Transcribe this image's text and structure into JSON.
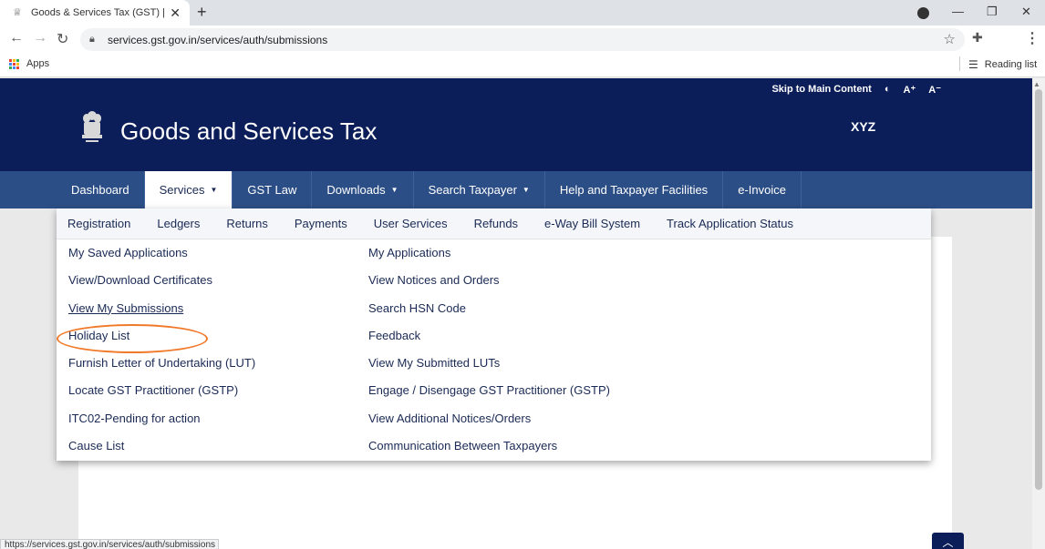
{
  "browser": {
    "tab_title": "Goods & Services Tax (GST) | User",
    "new_tab_symbol": "+",
    "url": "services.gst.gov.in/services/auth/submissions",
    "bookmarks": {
      "apps_label": "Apps",
      "reading_list_label": "Reading list"
    },
    "status_url": "https://services.gst.gov.in/services/auth/submissions"
  },
  "site": {
    "utility": {
      "skip_label": "Skip to Main Content",
      "contrast_symbol": "◐",
      "font_increase": "A⁺",
      "font_decrease": "A⁻"
    },
    "title": "Goods and Services Tax",
    "user_name": "XYZ",
    "nav": [
      {
        "label": "Dashboard",
        "dropdown": false
      },
      {
        "label": "Services",
        "dropdown": true
      },
      {
        "label": "GST Law",
        "dropdown": false
      },
      {
        "label": "Downloads",
        "dropdown": true
      },
      {
        "label": "Search Taxpayer",
        "dropdown": true
      },
      {
        "label": "Help and Taxpayer Facilities",
        "dropdown": false
      },
      {
        "label": "e-Invoice",
        "dropdown": false
      }
    ],
    "services_menu": {
      "subtabs": [
        "Registration",
        "Ledgers",
        "Returns",
        "Payments",
        "User Services",
        "Refunds",
        "e-Way Bill System",
        "Track Application Status"
      ],
      "left_links": [
        "My Saved Applications",
        "View/Download Certificates",
        "View My Submissions",
        "Holiday List",
        "Furnish Letter of Undertaking (LUT)",
        "Locate GST Practitioner (GSTP)",
        "ITC02-Pending for action",
        "Cause List"
      ],
      "right_links": [
        "My Applications",
        "View Notices and Orders",
        "Search HSN Code",
        "Feedback",
        "View My Submitted LUTs",
        "Engage / Disengage GST Practitioner (GSTP)",
        "View Additional Notices/Orders",
        "Communication Between Taxpayers"
      ],
      "highlighted_link": "View My Submissions"
    },
    "colors": {
      "header_bg": "#0b1e59",
      "nav_bg": "#2c4e86",
      "link": "#1a2a55",
      "highlight_oval": "#f07a2a"
    }
  }
}
